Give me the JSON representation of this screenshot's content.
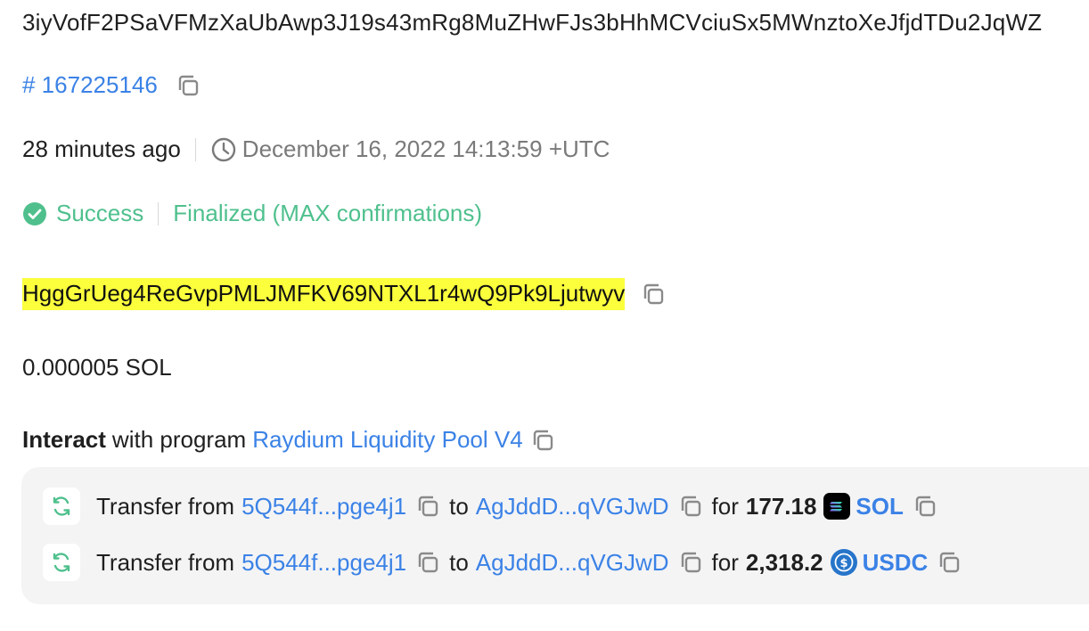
{
  "signature": "3iyVofF2PSaVFMzXaUbAwp3J19s43mRg8MuZHwFJs3bHhMCVciuSx5MWnztoXeJfjdTDu2JqWZ",
  "block": {
    "label": "# 167225146"
  },
  "time": {
    "relative": "28 minutes ago",
    "absolute": "December 16, 2022 14:13:59 +UTC"
  },
  "status": {
    "result": "Success",
    "confirmation": "Finalized (MAX confirmations)",
    "color": "#4fc08d"
  },
  "signer": "HggGrUeg4ReGvpPMLJMFKV69NTXL1r4wQ9Pk9Ljutwyv",
  "fee": "0.000005 SOL",
  "interact": {
    "verb": "Interact",
    "text": "with program",
    "program": "Raydium Liquidity Pool V4"
  },
  "transfers": [
    {
      "label": "Transfer from",
      "from": "5Q544f...pge4j1",
      "to_word": "to",
      "to": "AgJddD...qVGJwD",
      "for_word": "for",
      "amount": "177.18",
      "token": "SOL",
      "token_icon": "solana-logo-icon"
    },
    {
      "label": "Transfer from",
      "from": "5Q544f...pge4j1",
      "to_word": "to",
      "to": "AgJddD...qVGJwD",
      "for_word": "for",
      "amount": "2,318.2",
      "token": "USDC",
      "token_icon": "usdc-logo-icon"
    }
  ],
  "colors": {
    "link": "#3b82e6",
    "success": "#4fc08d",
    "highlight": "#fbff3c",
    "panel": "#f4f4f5"
  }
}
